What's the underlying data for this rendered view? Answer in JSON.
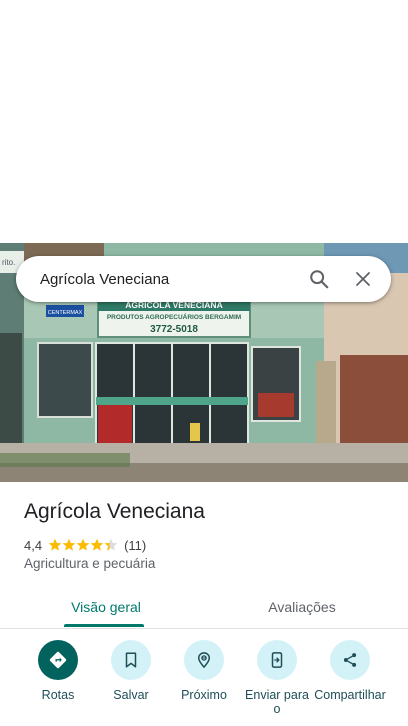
{
  "search": {
    "query": "Agrícola Veneciana"
  },
  "photo": {
    "sign_title": "AGRÍCOLA VENECIANA",
    "sign_subtitle": "PRODUTOS AGROPECUÁRIOS BERGAMIM",
    "sign_phone": "3772-5018",
    "left_sign_fragment": "rito.",
    "small_sign": "CENTERMAX"
  },
  "place": {
    "name": "Agrícola Veneciana",
    "rating": "4,4",
    "rating_value": 4.4,
    "reviews_count": "(11)",
    "category": "Agricultura e pecuária"
  },
  "tabs": [
    {
      "label": "Visão geral",
      "active": true
    },
    {
      "label": "Avaliações",
      "active": false
    }
  ],
  "actions": [
    {
      "label": "Rotas",
      "icon": "directions-icon"
    },
    {
      "label": "Salvar",
      "icon": "bookmark-icon"
    },
    {
      "label": "Próximo",
      "icon": "nearby-icon"
    },
    {
      "label": "Enviar para o",
      "icon": "send-to-phone-icon"
    },
    {
      "label": "Compartilhar",
      "icon": "share-icon"
    }
  ],
  "colors": {
    "accent": "#00796b",
    "action_primary": "#02625d",
    "action_bg": "#d3f2f7",
    "star": "#fbbc04"
  }
}
